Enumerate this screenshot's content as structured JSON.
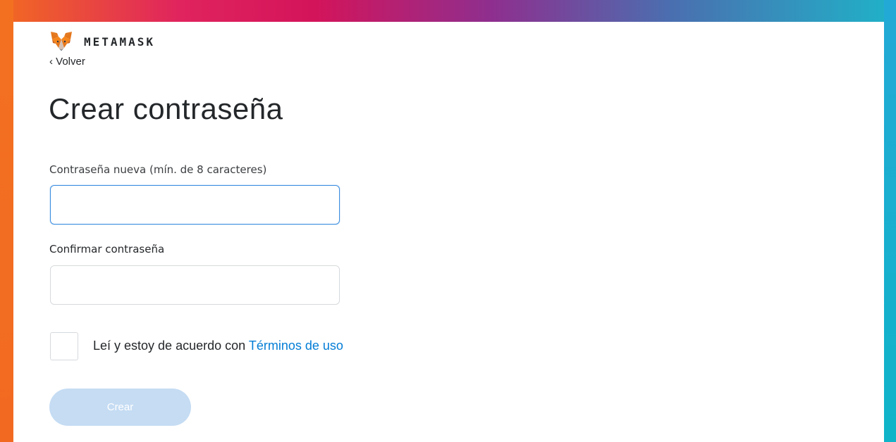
{
  "brand": {
    "logo_icon": "metamask-fox-icon",
    "name": "METAMASK"
  },
  "nav": {
    "back_label": "‹ Volver"
  },
  "page": {
    "title": "Crear contraseña"
  },
  "form": {
    "new_password": {
      "label": "Contraseña nueva (mín. de 8 caracteres)",
      "value": "",
      "placeholder": ""
    },
    "confirm_password": {
      "label": "Confirmar contraseña",
      "value": "",
      "placeholder": ""
    },
    "terms": {
      "checked": false,
      "text": "Leí y estoy de acuerdo con ",
      "link_text": "Términos de uso"
    },
    "submit_label": "Crear"
  },
  "colors": {
    "accent": "#037dd6",
    "button_disabled": "#c5dcf3",
    "focus_border": "#3c8de0",
    "frame_left": "#f26a21",
    "frame_right": "#0fb4c8"
  }
}
